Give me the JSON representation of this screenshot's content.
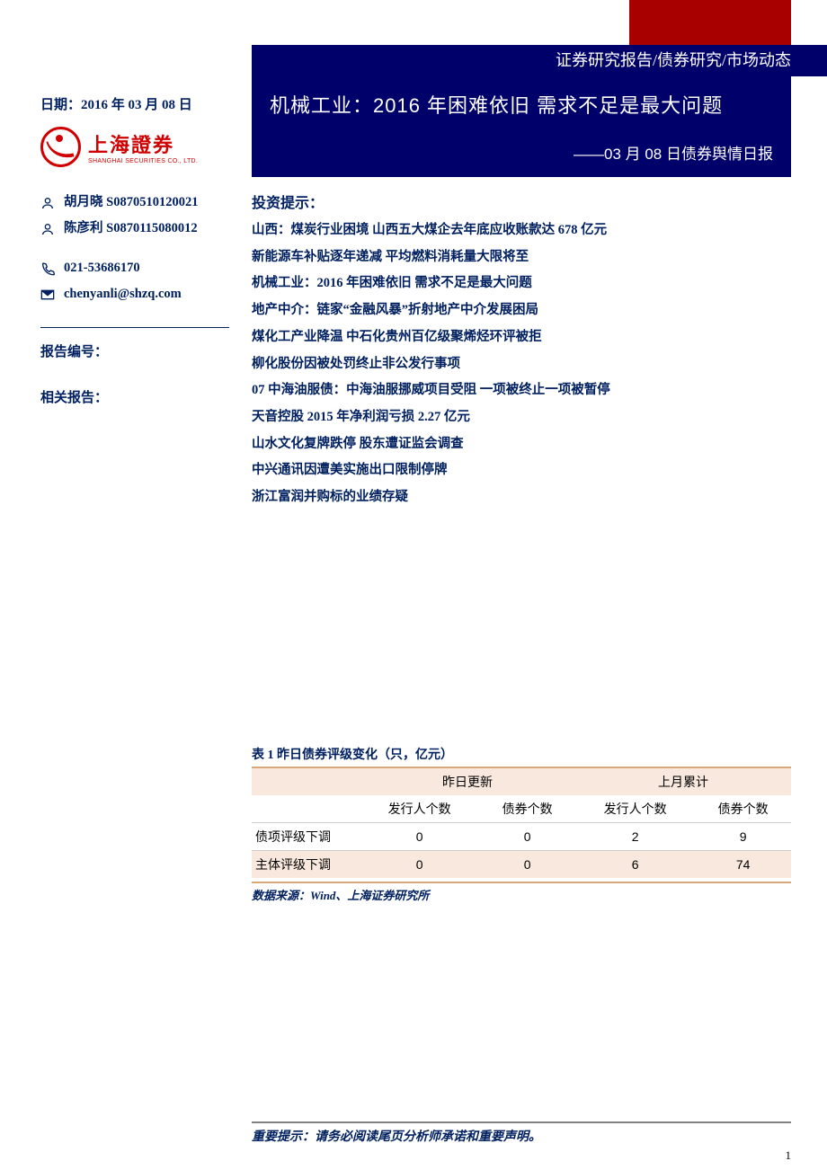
{
  "breadcrumb": "证券研究报告/债券研究/市场动态",
  "title": {
    "main": "机械工业：2016 年困难依旧 需求不足是最大问题",
    "sub": "——03 月 08 日债券舆情日报"
  },
  "sidebar": {
    "date_label": "日期：2016 年 03 月 08 日",
    "logo_cn": "上海證券",
    "logo_en": "SHANGHAI SECURITIES CO., LTD.",
    "analysts": [
      {
        "name": "胡月晓  S0870510120021"
      },
      {
        "name": "陈彦利  S0870115080012"
      }
    ],
    "phone": "021-53686170",
    "email": "chenyanli@shzq.com",
    "report_no_label": "报告编号：",
    "related_label": "相关报告："
  },
  "tips": {
    "header": "投资提示：",
    "items": [
      "山西：煤炭行业困境 山西五大煤企去年底应收账款达 678 亿元",
      "新能源车补贴逐年递减 平均燃料消耗量大限将至",
      "机械工业：2016 年困难依旧 需求不足是最大问题",
      "地产中介：链家“金融风暴”折射地产中介发展困局",
      "煤化工产业降温 中石化贵州百亿级聚烯烃环评被拒",
      "柳化股份因被处罚终止非公发行事项",
      "07 中海油服债：中海油服挪威项目受阻 一项被终止一项被暂停",
      "天音控股 2015 年净利润亏损 2.27 亿元",
      "山水文化复牌跌停 股东遭证监会调查",
      "中兴通讯因遭美实施出口限制停牌",
      "浙江富润并购标的业绩存疑"
    ]
  },
  "table": {
    "caption": "表 1 昨日债券评级变化（只，亿元）",
    "group_headers": [
      "昨日更新",
      "上月累计"
    ],
    "columns": [
      "发行人个数",
      "债券个数",
      "发行人个数",
      "债券个数"
    ],
    "rows": [
      {
        "label": "债项评级下调",
        "values": [
          "0",
          "0",
          "2",
          "9"
        ]
      },
      {
        "label": "主体评级下调",
        "values": [
          "0",
          "0",
          "6",
          "74"
        ]
      }
    ],
    "source": "数据来源：Wind、上海证券研究所"
  },
  "footer": {
    "notice": "重要提示：请务必阅读尾页分析师承诺和重要声明。",
    "page": "1"
  },
  "chart_data": {
    "type": "table",
    "title": "表 1 昨日债券评级变化（只，亿元）",
    "columns": [
      "",
      "昨日更新-发行人个数",
      "昨日更新-债券个数",
      "上月累计-发行人个数",
      "上月累计-债券个数"
    ],
    "rows": [
      [
        "债项评级下调",
        0,
        0,
        2,
        9
      ],
      [
        "主体评级下调",
        0,
        0,
        6,
        74
      ]
    ]
  }
}
